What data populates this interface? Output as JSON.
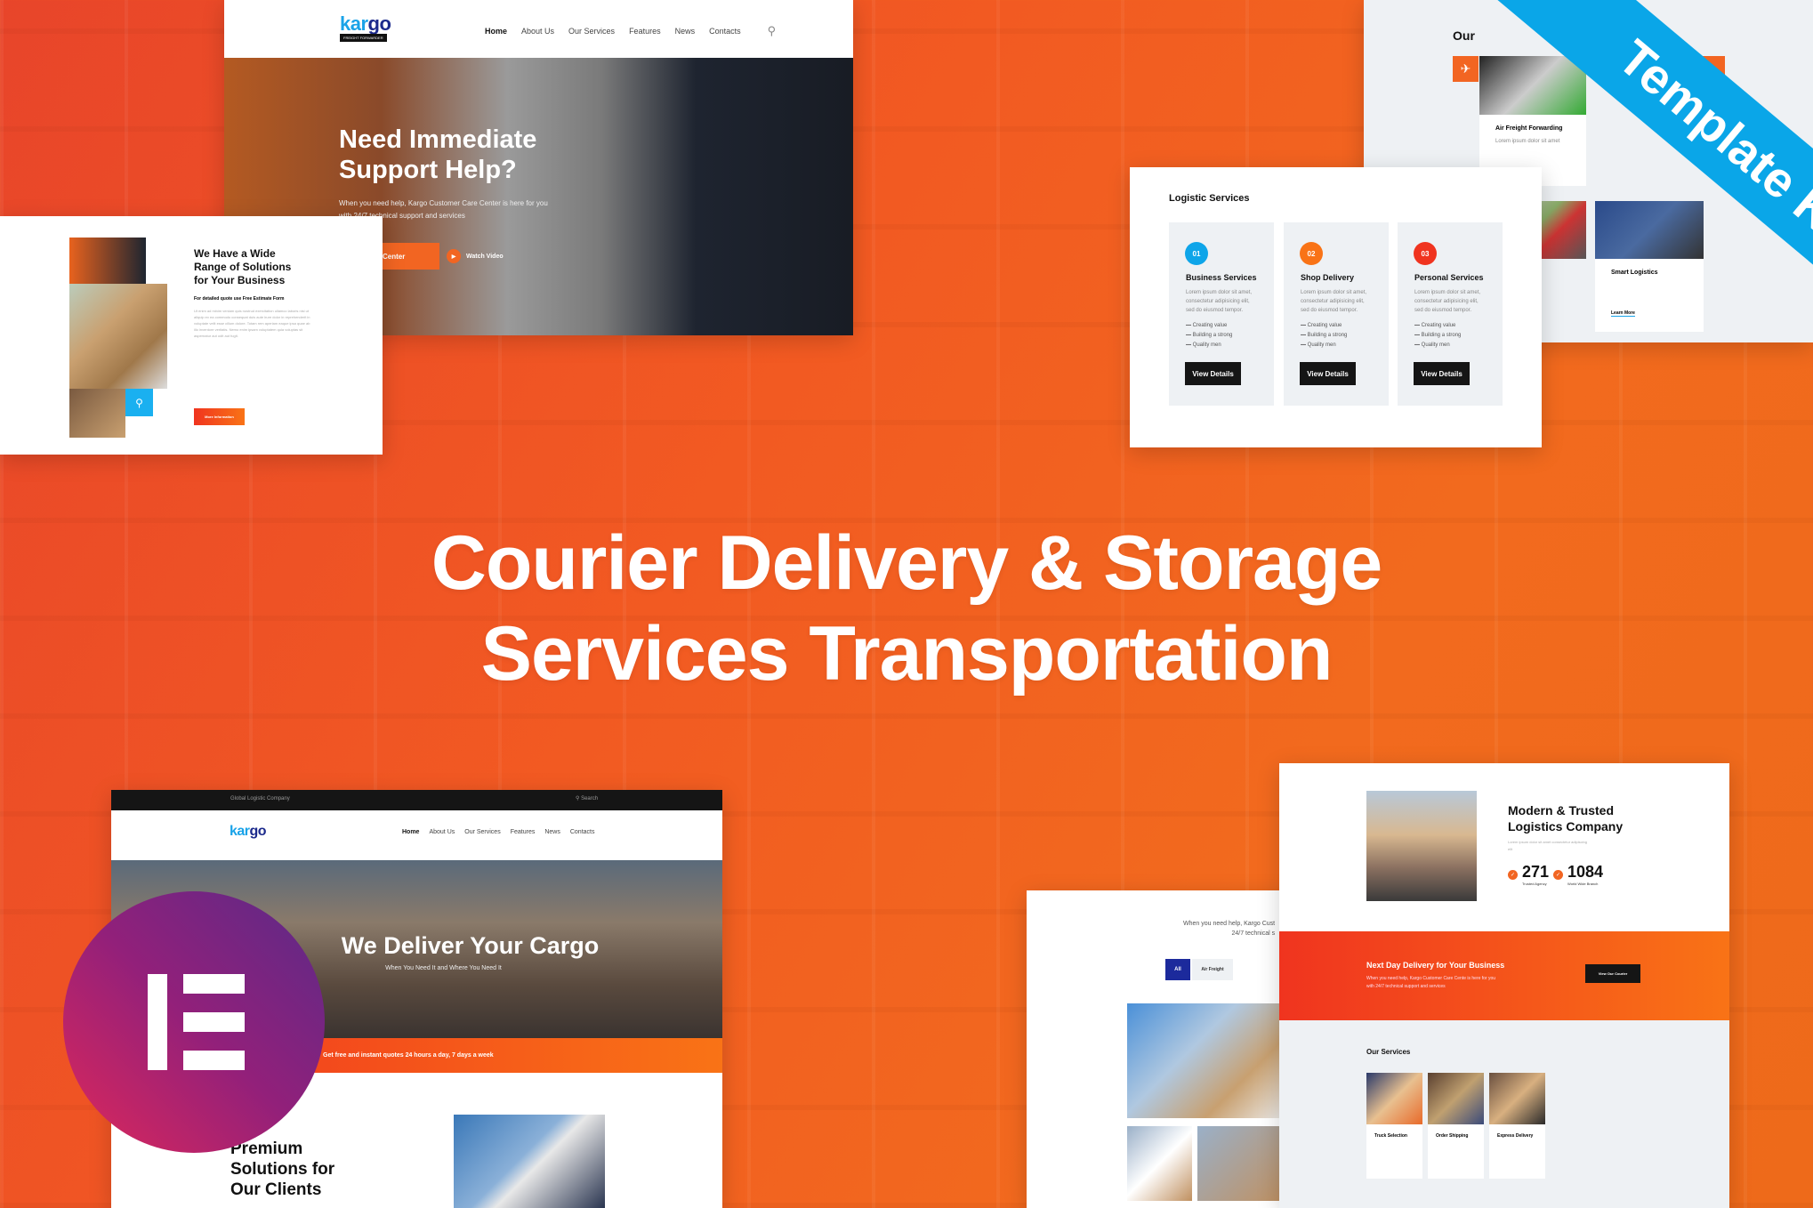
{
  "colors": {
    "brand_orange": "#f26522",
    "ribbon_blue": "#0aa6e8",
    "elementor": "#92003b",
    "dark": "#151515"
  },
  "headline": {
    "line1": "Courier Delivery & Storage",
    "line2": "Services Transportation"
  },
  "ribbon": "Template Kit",
  "hero_top": {
    "logo_a": "kar",
    "logo_b": "go",
    "tagline": "FREIGHT FORWARDER",
    "nav": [
      "Home",
      "About Us",
      "Our Services",
      "Features",
      "News",
      "Contacts"
    ],
    "search_icon": "search-icon",
    "title1": "Need Immediate",
    "title2": "Support Help?",
    "text1": "When you need help, Kargo Customer Care Center is here for you",
    "text2": "with 24/7 technical support and services",
    "cta": "Center",
    "video": "Watch Video"
  },
  "solutions": {
    "title1": "We Have a Wide",
    "title2": "Range of Solutions",
    "title3": "for Your Business",
    "sub": "For detailed quote use Free Estimate Form",
    "button": "More Information"
  },
  "logistic": {
    "title": "Logistic Services",
    "cards": [
      {
        "num": "01",
        "color": "#0ea5e9",
        "title": "Business Services",
        "text": "Lorem ipsum dolor sit amet, consectetur adipisicing elit, sed do eiusmod tempor.",
        "items": [
          "Creating value",
          "Building a strong",
          "Quality men"
        ],
        "button": "View Details"
      },
      {
        "num": "02",
        "color": "#f97316",
        "title": "Shop Delivery",
        "text": "Lorem ipsum dolor sit amet, consectetur adipisicing elit, sed do eiusmod tempor.",
        "items": [
          "Creating value",
          "Building a strong",
          "Quality men"
        ],
        "button": "View Details"
      },
      {
        "num": "03",
        "color": "#f0341f",
        "title": "Personal Services",
        "text": "Lorem ipsum dolor sit amet, consectetur adipisicing elit, sed do eiusmod tempor.",
        "items": [
          "Creating value",
          "Building a strong",
          "Quality men"
        ],
        "button": "View Details"
      }
    ]
  },
  "our_top": {
    "title": "Our",
    "card1": "Air Freight Forwarding",
    "card2": "Smart Logistics",
    "learn": "Learn More"
  },
  "bottom_left": {
    "topbar": "Global Logistic Company",
    "search": "Search",
    "logo_a": "kar",
    "logo_b": "go",
    "nav": [
      "Home",
      "About Us",
      "Our Services",
      "Features",
      "News",
      "Contacts"
    ],
    "hero": "We Deliver Your Cargo",
    "hero_sub": "When You Need It and Where You Need It",
    "strip": "Get free and instant quotes 24 hours a day, 7 days a week",
    "title1": "Premium",
    "title2": "Solutions for",
    "title3": "Our Clients"
  },
  "bottom_mid": {
    "text1": "When you need help, Kargo Cust",
    "text2": "24/7 technical s",
    "tab_all": "All",
    "tab_air": "Air Freight"
  },
  "bottom_right": {
    "title1": "Modern & Trusted",
    "title2": "Logistics Company",
    "stat1": "271",
    "stat1_label": "Trusted Agency",
    "stat2": "1084",
    "stat2_label": "World Wide Branch",
    "banner_title": "Next Day Delivery for Your Business",
    "banner_text1": "When you need help, Kargo Customer Care Cente is here for you",
    "banner_text2": "with 24/7 technical support and services",
    "banner_btn": "View Our Courier",
    "services_title": "Our Services",
    "services": [
      "Truck Selection",
      "Order Shipping",
      "Express Delivery"
    ]
  }
}
